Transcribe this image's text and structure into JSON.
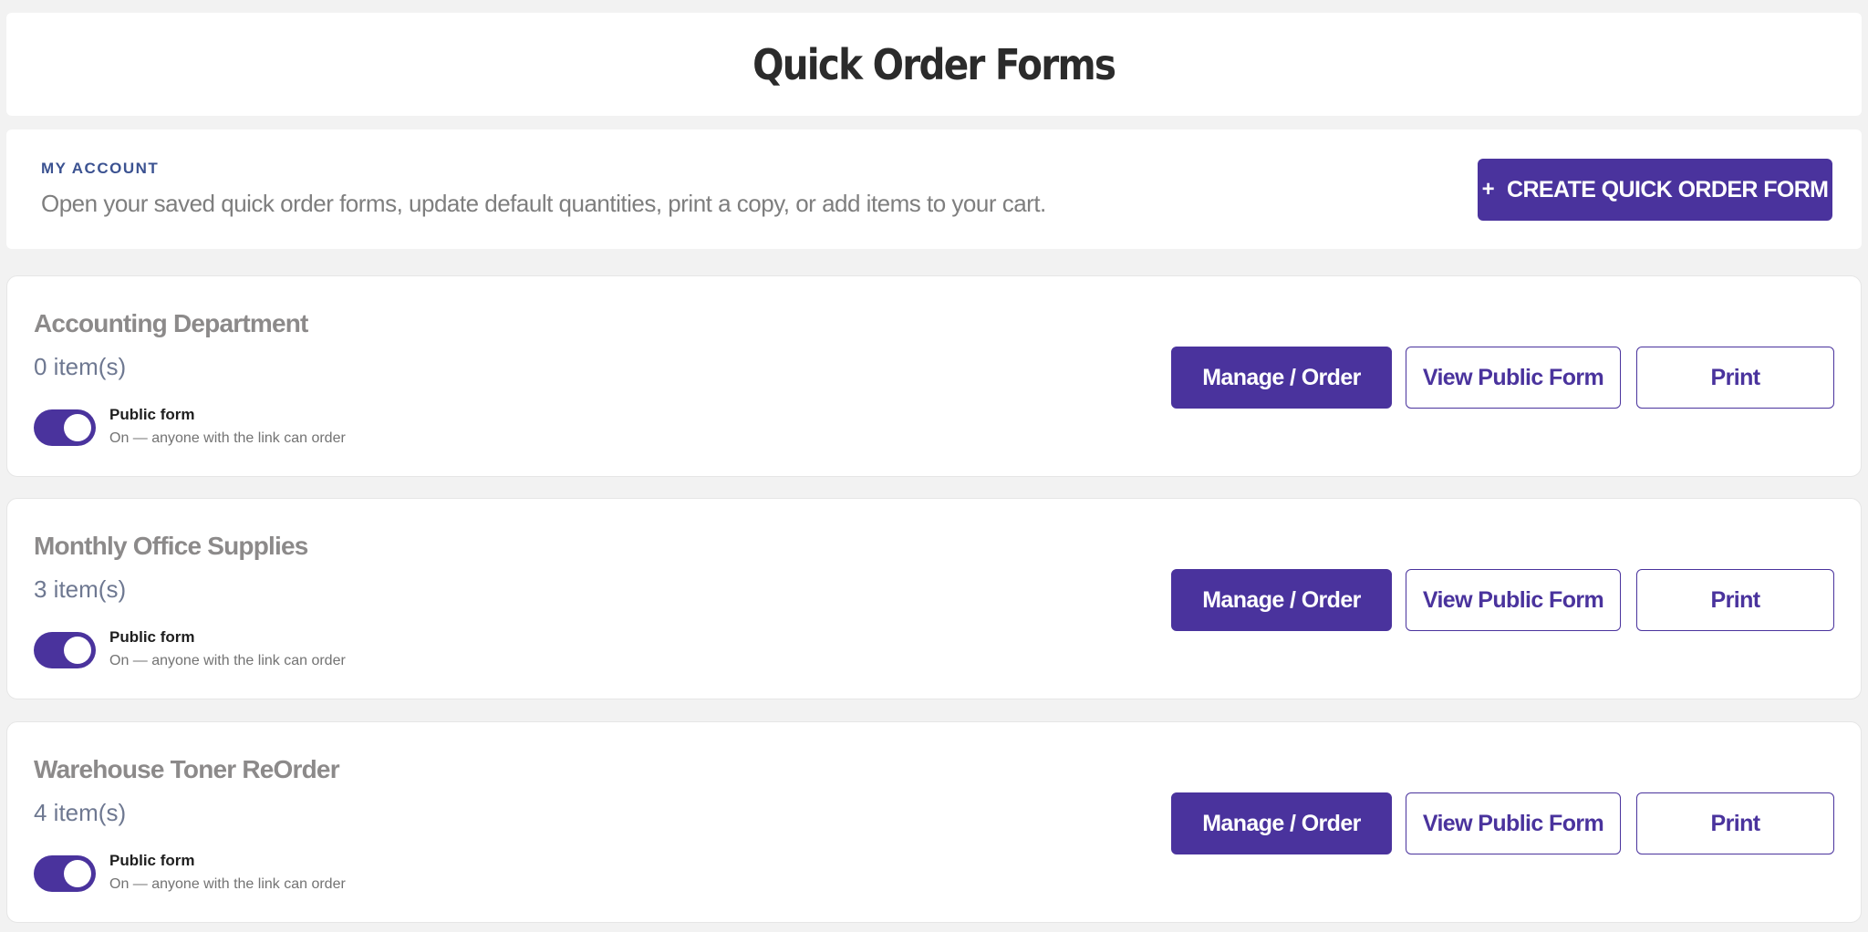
{
  "header": {
    "title": "Quick Order Forms"
  },
  "account": {
    "label": "MY ACCOUNT",
    "description": "Open your saved quick order forms, update default quantities, print a copy, or add items to your cart.",
    "create_button": {
      "icon": "+",
      "label": "CREATE QUICK ORDER FORM"
    }
  },
  "forms": [
    {
      "name": "Accounting Department",
      "item_count": "0 item(s)",
      "public_toggle": {
        "on": true,
        "label": "Public form",
        "status": "On — anyone with the link can order"
      },
      "buttons": {
        "manage": "Manage / Order",
        "view_public": "View Public Form",
        "print": "Print"
      }
    },
    {
      "name": "Monthly Office Supplies",
      "item_count": "3 item(s)",
      "public_toggle": {
        "on": true,
        "label": "Public form",
        "status": "On — anyone with the link can order"
      },
      "buttons": {
        "manage": "Manage / Order",
        "view_public": "View Public Form",
        "print": "Print"
      }
    },
    {
      "name": "Warehouse Toner ReOrder",
      "item_count": "4 item(s)",
      "public_toggle": {
        "on": true,
        "label": "Public form",
        "status": "On — anyone with the link can order"
      },
      "buttons": {
        "manage": "Manage / Order",
        "view_public": "View Public Form",
        "print": "Print"
      }
    }
  ],
  "colors": {
    "accent": "#4a339d",
    "account_label": "#3b5291",
    "background": "#f2f2f2"
  }
}
